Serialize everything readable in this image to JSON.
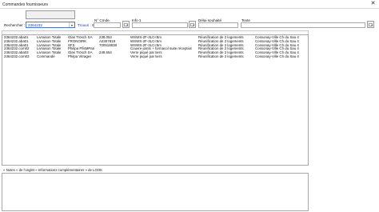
{
  "window": {
    "title": "Commandes fournisseurs",
    "close_glyph": "✕"
  },
  "search": {
    "label": "Rechercher :",
    "value": "2364232",
    "found": "Trouvé : 6"
  },
  "fields": {
    "no_cmde_label": "N° Cmde.",
    "info1_label": "Info 1",
    "date_label": "Délai souhaité",
    "texte_label": "Texte"
  },
  "table": {
    "rows": [
      [
        "2364232.aba01",
        "Livraison Totale",
        "Glas Trösch SA",
        "238.053",
        "WSWS-2F-3LC<5m",
        "Réunification de 2 logements",
        "Cossonay-Ville Ch du Sau 4"
      ],
      [
        "2364232.aba01",
        "Livraison Totale",
        "FRONOIRK",
        "A2307819",
        "WSWS-2F-3LC<5m",
        "Réunification de 2 logements",
        "Cossonay-Ville Ch du Sau 4"
      ],
      [
        "2364232.aba01",
        "Livraison Totale",
        "SFS",
        "700518838",
        "WSWS-2F-3LC<5m",
        "Réunification de 2 logements",
        "Cossonay-Ville Ch du Sau 4"
      ],
      [
        "2364232.com02",
        "Livraison Totale",
        "Philipa PfisMPan",
        "",
        "Couvre-joints + formacol suite réception",
        "Réunification de 2 logements",
        "Cossonay-Ville Ch du Sau 4"
      ],
      [
        "2364232.aba03",
        "Livraison Totale",
        "Glas Trösch SA",
        "249.554",
        "Verre piqué par tiers",
        "Réunification de 2 logements",
        "Cossonay-Ville Ch du Sau 4"
      ],
      [
        "2364232.com03",
        "Commandé",
        "Philpa Vitrages",
        "",
        "Verre piqué par tiers",
        "Réunification de 2 logements",
        "Cossonay-Ville Ch du Sau 4"
      ]
    ]
  },
  "notes": {
    "label": "« Notes » de l'onglet « Informations complémentaires » de LOOK"
  },
  "icons": {
    "action": "lookup-icon"
  }
}
